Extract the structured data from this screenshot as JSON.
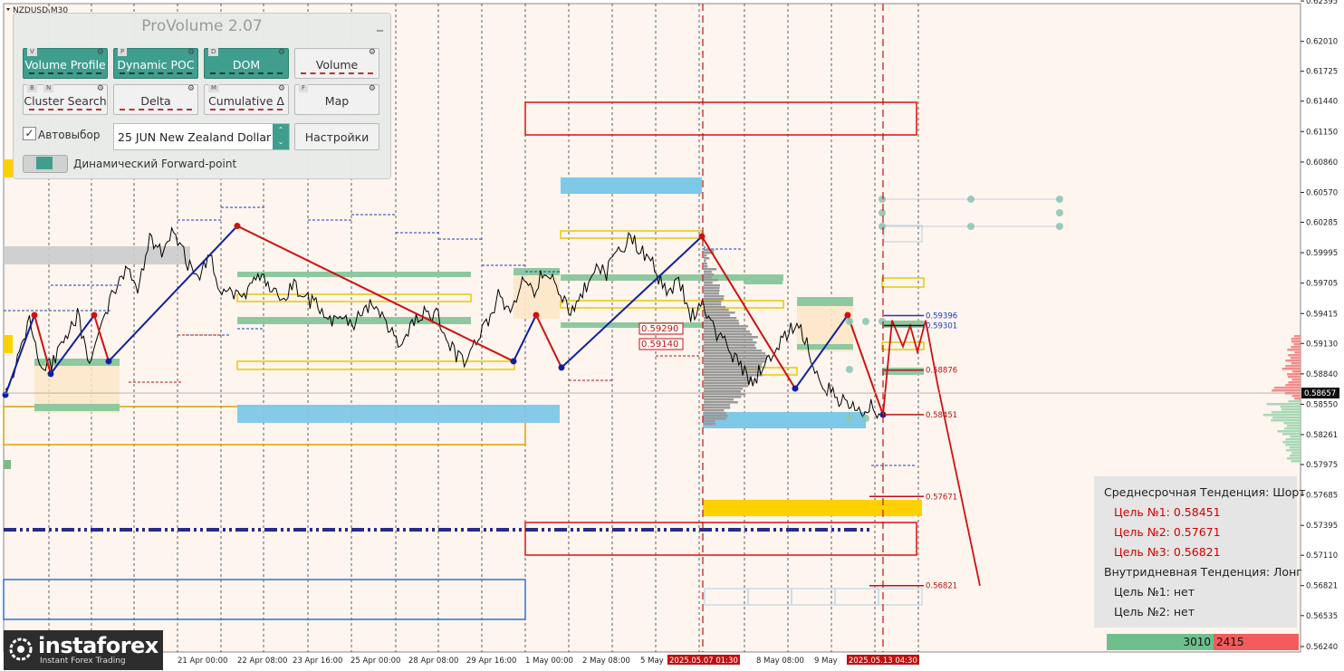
{
  "symbol_label": "NZDUSD,M30",
  "panel": {
    "title": "ProVolume 2.07",
    "minimize": "_",
    "buttons": [
      {
        "label": "Volume Profile",
        "key": "V",
        "on": true
      },
      {
        "label": "Dynamic POC",
        "key": "P",
        "on": true
      },
      {
        "label": "DOM",
        "key": "D",
        "on": true
      },
      {
        "label": "Volume",
        "key": "",
        "on": false
      },
      {
        "label": "Cluster Search",
        "key": "B",
        "key2": "N",
        "on": false
      },
      {
        "label": "Delta",
        "key": "",
        "on": false
      },
      {
        "label": "Cumulative Δ",
        "key": "M",
        "on": false
      },
      {
        "label": "Map",
        "key": "F",
        "on": false
      }
    ],
    "autoselect_label": "Автовыбор",
    "autoselect_checked": "✓",
    "instrument_value": "25 JUN New Zealand Dollar",
    "settings_label": "Настройки",
    "forward_label": "Динамический Forward-point"
  },
  "trend_box": {
    "medium_title": "Среднесрочная Тенденция: Шорт",
    "medium_targets": [
      "Цель №1: 0.58451",
      "Цель №2: 0.57671",
      "Цель №3: 0.56821"
    ],
    "intraday_title": "Внутридневная Тенденция: Лонг",
    "intraday_targets": [
      "Цель №1: нет",
      "Цель №2: нет"
    ]
  },
  "volume_bar": {
    "left_value": "3010",
    "right_value": "2415",
    "green": "#6fbf8e",
    "red": "#f25c5c"
  },
  "logo": {
    "name": "instaforex",
    "sub": "Instant Forex Trading"
  },
  "colors": {
    "bg": "#fef5ef",
    "grid": "#222222",
    "up_line": "#1020a0",
    "down_line": "#d01010",
    "teal": "#8ec8a0",
    "yellow": "#ffd000",
    "blue_zone": "#7ec8e8",
    "red_zone": "#dd1010"
  },
  "chart_data": {
    "type": "line",
    "symbol": "NZDUSD",
    "timeframe": "M30",
    "ylim": [
      0.5624,
      0.6237
    ],
    "y_ticks": [
      0.62395,
      0.6201,
      0.61725,
      0.6144,
      0.6115,
      0.6086,
      0.6057,
      0.60285,
      0.59995,
      0.59705,
      0.59415,
      0.5913,
      0.5884,
      0.5855,
      0.58261,
      0.57975,
      0.57685,
      0.57395,
      0.5711,
      0.56821,
      0.56535,
      0.5624
    ],
    "y_tick_labels": [
      "0.62395",
      "0.62010",
      "0.61725",
      "0.61440",
      "0.61150",
      "0.60860",
      "0.60570",
      "0.60285",
      "0.59995",
      "0.59705",
      "0.59415",
      "0.59130",
      "0.58840",
      "0.58550",
      "0.58261",
      "0.57975",
      "0.57685",
      "0.57395",
      "0.57110",
      "0.56821",
      "0.56535",
      "0.56240"
    ],
    "x_labels": [
      "21 Apr 00:00",
      "22 Apr 08:00",
      "23 Apr 16:00",
      "25 Apr 00:00",
      "28 Apr 08:00",
      "29 Apr 16:00",
      "1 May 00:00",
      "2 May 08:00",
      "5 May",
      "8 May 08:00",
      "9 May"
    ],
    "highlighted_times": [
      "2025.05.07 01:30",
      "2025.05.13 04:30"
    ],
    "current_price": "0.58657",
    "price_path": [
      0.5864,
      0.5895,
      0.594,
      0.5884,
      0.5896,
      0.5922,
      0.594,
      0.5894,
      0.593,
      0.5965,
      0.598,
      0.5968,
      0.601,
      0.5998,
      0.6025,
      0.5992,
      0.5978,
      0.5995,
      0.596,
      0.5962,
      0.596,
      0.598,
      0.597,
      0.5958,
      0.5968,
      0.5955,
      0.595,
      0.5935,
      0.594,
      0.593,
      0.595,
      0.5945,
      0.5925,
      0.5905,
      0.5935,
      0.5945,
      0.5938,
      0.591,
      0.5895,
      0.591,
      0.593,
      0.5958,
      0.5945,
      0.5975,
      0.5965,
      0.5985,
      0.5965,
      0.5945,
      0.596,
      0.5985,
      0.598,
      0.6,
      0.6015,
      0.6,
      0.5985,
      0.596,
      0.5975,
      0.594,
      0.595,
      0.5925,
      0.591,
      0.5895,
      0.5875,
      0.589,
      0.5905,
      0.592,
      0.5935,
      0.59,
      0.5875,
      0.5862,
      0.5855,
      0.5848,
      0.5852,
      0.5845
    ],
    "zigzag": [
      [
        0.5864,
        "up"
      ],
      [
        0.594,
        "down"
      ],
      [
        0.5884,
        "up"
      ],
      [
        0.594,
        "down"
      ],
      [
        0.5896,
        "up"
      ],
      [
        0.6025,
        "down"
      ],
      [
        0.5896,
        "up"
      ],
      [
        0.594,
        "down"
      ],
      [
        0.589,
        "up"
      ],
      [
        0.6015,
        "down"
      ],
      [
        0.587,
        "up"
      ],
      [
        0.594,
        "down"
      ],
      [
        0.5845,
        "up"
      ]
    ],
    "levels": [
      {
        "price": "0.59396",
        "label": "0.59396"
      },
      {
        "price": "0.59301",
        "label": "0.59301"
      },
      {
        "price": "0.58876",
        "label": "0.58876"
      },
      {
        "price": "0.58451",
        "label": "0.58451"
      },
      {
        "price": "0.57671",
        "label": "0.57671"
      },
      {
        "price": "0.56821",
        "label": "0.56821"
      },
      {
        "price": "0.59290",
        "label": "0.59290"
      },
      {
        "price": "0.59140",
        "label": "0.59140"
      }
    ],
    "forecast": [
      0.5845,
      0.5935,
      0.591,
      0.593,
      0.5905,
      0.5935,
      0.5875,
      0.5682
    ]
  }
}
